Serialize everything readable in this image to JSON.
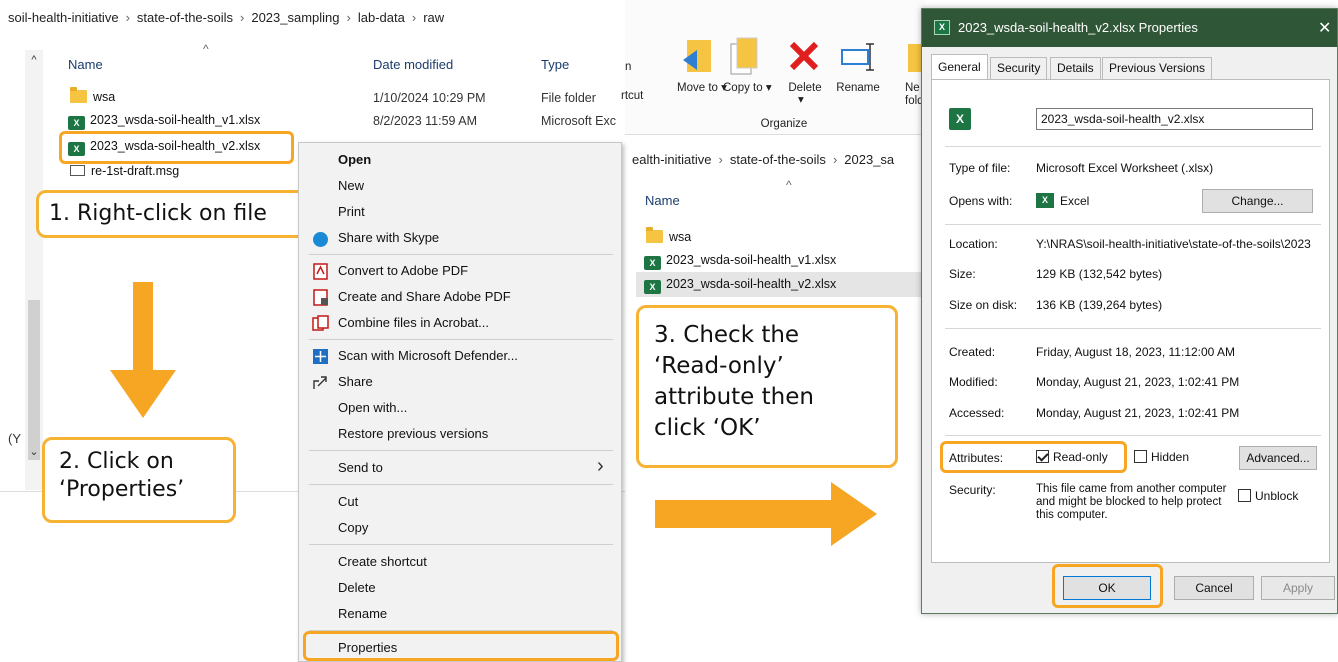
{
  "left_explorer": {
    "breadcrumb": [
      "soil-health-initiative",
      "state-of-the-soils",
      "2023_sampling",
      "lab-data",
      "raw"
    ],
    "columns": {
      "name": "Name",
      "date": "Date modified",
      "type": "Type"
    },
    "files": [
      {
        "name": "wsa",
        "date": "1/10/2024 10:29 PM",
        "type": "File folder",
        "icon": "folder-icon"
      },
      {
        "name": "2023_wsda-soil-health_v1.xlsx",
        "date": "8/2/2023 11:59 AM",
        "type": "Microsoft Exc",
        "icon": "excel-file-icon"
      },
      {
        "name": "2023_wsda-soil-health_v2.xlsx",
        "date": "",
        "type": "",
        "icon": "excel-file-icon"
      },
      {
        "name": "re-1st-draft.msg",
        "date": "",
        "type": "",
        "icon": "mail-icon"
      }
    ],
    "edge_text": "(Y"
  },
  "context_menu": {
    "items": [
      "Open",
      "New",
      "Print",
      "Share with Skype",
      "Convert to Adobe PDF",
      "Create and Share Adobe PDF",
      "Combine files in Acrobat...",
      "Scan with Microsoft Defender...",
      "Share",
      "Open with...",
      "Restore previous versions",
      "Send to",
      "Cut",
      "Copy",
      "Create shortcut",
      "Delete",
      "Rename",
      "Properties"
    ],
    "submenu_arrow": "›"
  },
  "mid_explorer": {
    "ribbon": {
      "partial_left": "n",
      "partial_shortcut": "rtcut",
      "move_to": "Move to ▾",
      "copy_to": "Copy to ▾",
      "delete": "Delete",
      "rename": "Rename",
      "partial_new": "Ne fold",
      "group": "Organize"
    },
    "breadcrumb": [
      "ealth-initiative",
      "state-of-the-soils",
      "2023_sa"
    ],
    "column_name": "Name",
    "files": [
      "wsa",
      "2023_wsda-soil-health_v1.xlsx",
      "2023_wsda-soil-health_v2.xlsx"
    ]
  },
  "properties_dialog": {
    "title": "2023_wsda-soil-health_v2.xlsx Properties",
    "close": "✕",
    "tabs": [
      "General",
      "Security",
      "Details",
      "Previous Versions"
    ],
    "filename": "2023_wsda-soil-health_v2.xlsx",
    "type_label": "Type of file:",
    "type_value": "Microsoft Excel Worksheet (.xlsx)",
    "opens_label": "Opens with:",
    "opens_value": "Excel",
    "change_button": "Change...",
    "location_label": "Location:",
    "location_value": "Y:\\NRAS\\soil-health-initiative\\state-of-the-soils\\2023",
    "size_label": "Size:",
    "size_value": "129 KB (132,542 bytes)",
    "size_disk_label": "Size on disk:",
    "size_disk_value": "136 KB (139,264 bytes)",
    "created_label": "Created:",
    "created_value": "Friday, August 18, 2023, 11:12:00 AM",
    "modified_label": "Modified:",
    "modified_value": "Monday, August 21, 2023, 1:02:41 PM",
    "accessed_label": "Accessed:",
    "accessed_value": "Monday, August 21, 2023, 1:02:41 PM",
    "attributes_label": "Attributes:",
    "readonly_label": "Read-only",
    "hidden_label": "Hidden",
    "advanced_button": "Advanced...",
    "security_label": "Security:",
    "security_text": "This file came from another computer and might be blocked to help protect this computer.",
    "unblock_label": "Unblock",
    "ok_button": "OK",
    "cancel_button": "Cancel",
    "apply_button": "Apply"
  },
  "callouts": {
    "step1": "1. Right-click on file",
    "step2_line1": "2. Click on",
    "step2_line2": "‘Properties’",
    "step3_line1": "3. Check the",
    "step3_line2": "‘Read-only’",
    "step3_line3": "attribute then",
    "step3_line4": "click ‘OK’"
  },
  "colors": {
    "accent": "#f6a623",
    "dialog_title": "#2f5636",
    "excel_green": "#1d7544"
  }
}
